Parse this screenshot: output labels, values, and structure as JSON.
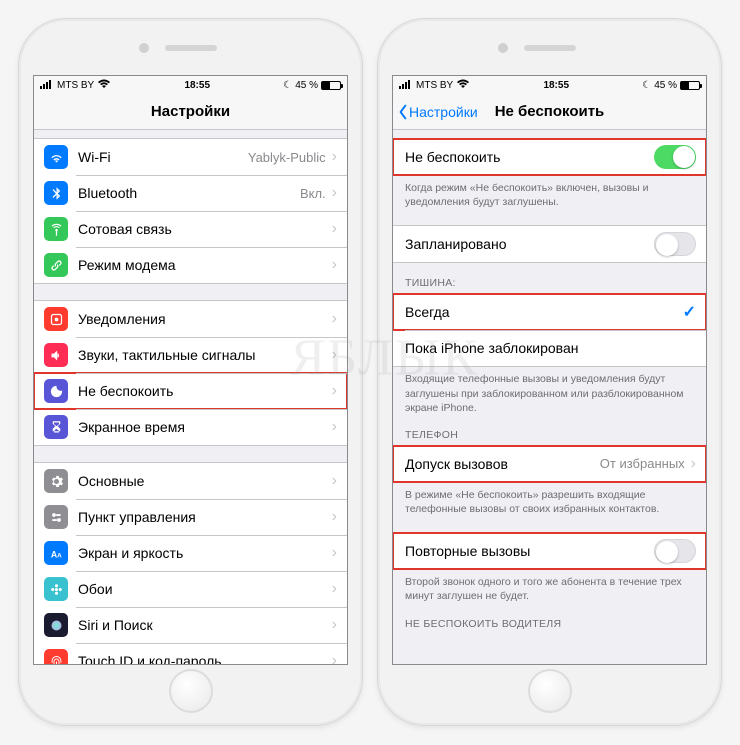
{
  "status": {
    "carrier": "MTS BY",
    "time": "18:55",
    "battery": "45 %"
  },
  "watermark": "ЯБЛЫК",
  "left": {
    "title": "Настройки",
    "group1": [
      {
        "icon": "wifi",
        "color": "#007aff",
        "label": "Wi-Fi",
        "value": "Yablyk-Public"
      },
      {
        "icon": "bluetooth",
        "color": "#007aff",
        "label": "Bluetooth",
        "value": "Вкл."
      },
      {
        "icon": "antenna",
        "color": "#34c759",
        "label": "Сотовая связь",
        "value": ""
      },
      {
        "icon": "link",
        "color": "#34c759",
        "label": "Режим модема",
        "value": ""
      }
    ],
    "group2": [
      {
        "icon": "bell",
        "color": "#ff3b30",
        "label": "Уведомления"
      },
      {
        "icon": "speaker",
        "color": "#ff2d55",
        "label": "Звуки, тактильные сигналы"
      },
      {
        "icon": "moon",
        "color": "#5856d6",
        "label": "Не беспокоить",
        "highlight": true
      },
      {
        "icon": "hourglass",
        "color": "#5856d6",
        "label": "Экранное время"
      }
    ],
    "group3": [
      {
        "icon": "gear",
        "color": "#8e8e93",
        "label": "Основные"
      },
      {
        "icon": "switches",
        "color": "#8e8e93",
        "label": "Пункт управления"
      },
      {
        "icon": "aa",
        "color": "#007aff",
        "label": "Экран и яркость"
      },
      {
        "icon": "flower",
        "color": "#38c1cf",
        "label": "Обои"
      },
      {
        "icon": "siri",
        "color": "#1b1b2f",
        "label": "Siri и Поиск"
      },
      {
        "icon": "touchid",
        "color": "#ff3b30",
        "label": "Touch ID и код-пароль"
      }
    ]
  },
  "right": {
    "back": "Настройки",
    "title": "Не беспокоить",
    "dnd_label": "Не беспокоить",
    "dnd_footer": "Когда режим «Не беспокоить» включен, вызовы и уведомления будут заглушены.",
    "scheduled_label": "Запланировано",
    "silence_header": "ТИШИНА:",
    "silence_always": "Всегда",
    "silence_locked": "Пока iPhone заблокирован",
    "silence_footer": "Входящие телефонные вызовы и уведомления будут заглушены при заблокированном или разблокированном экране iPhone.",
    "phone_header": "ТЕЛЕФОН",
    "allow_calls_label": "Допуск вызовов",
    "allow_calls_value": "От избранных",
    "allow_calls_footer": "В режиме «Не беспокоить» разрешить входящие телефонные вызовы от своих избранных контактов.",
    "repeat_label": "Повторные вызовы",
    "repeat_footer": "Второй звонок одного и того же абонента в течение трех минут заглушен не будет.",
    "driving_header": "НЕ БЕСПОКОИТЬ ВОДИТЕЛЯ"
  }
}
